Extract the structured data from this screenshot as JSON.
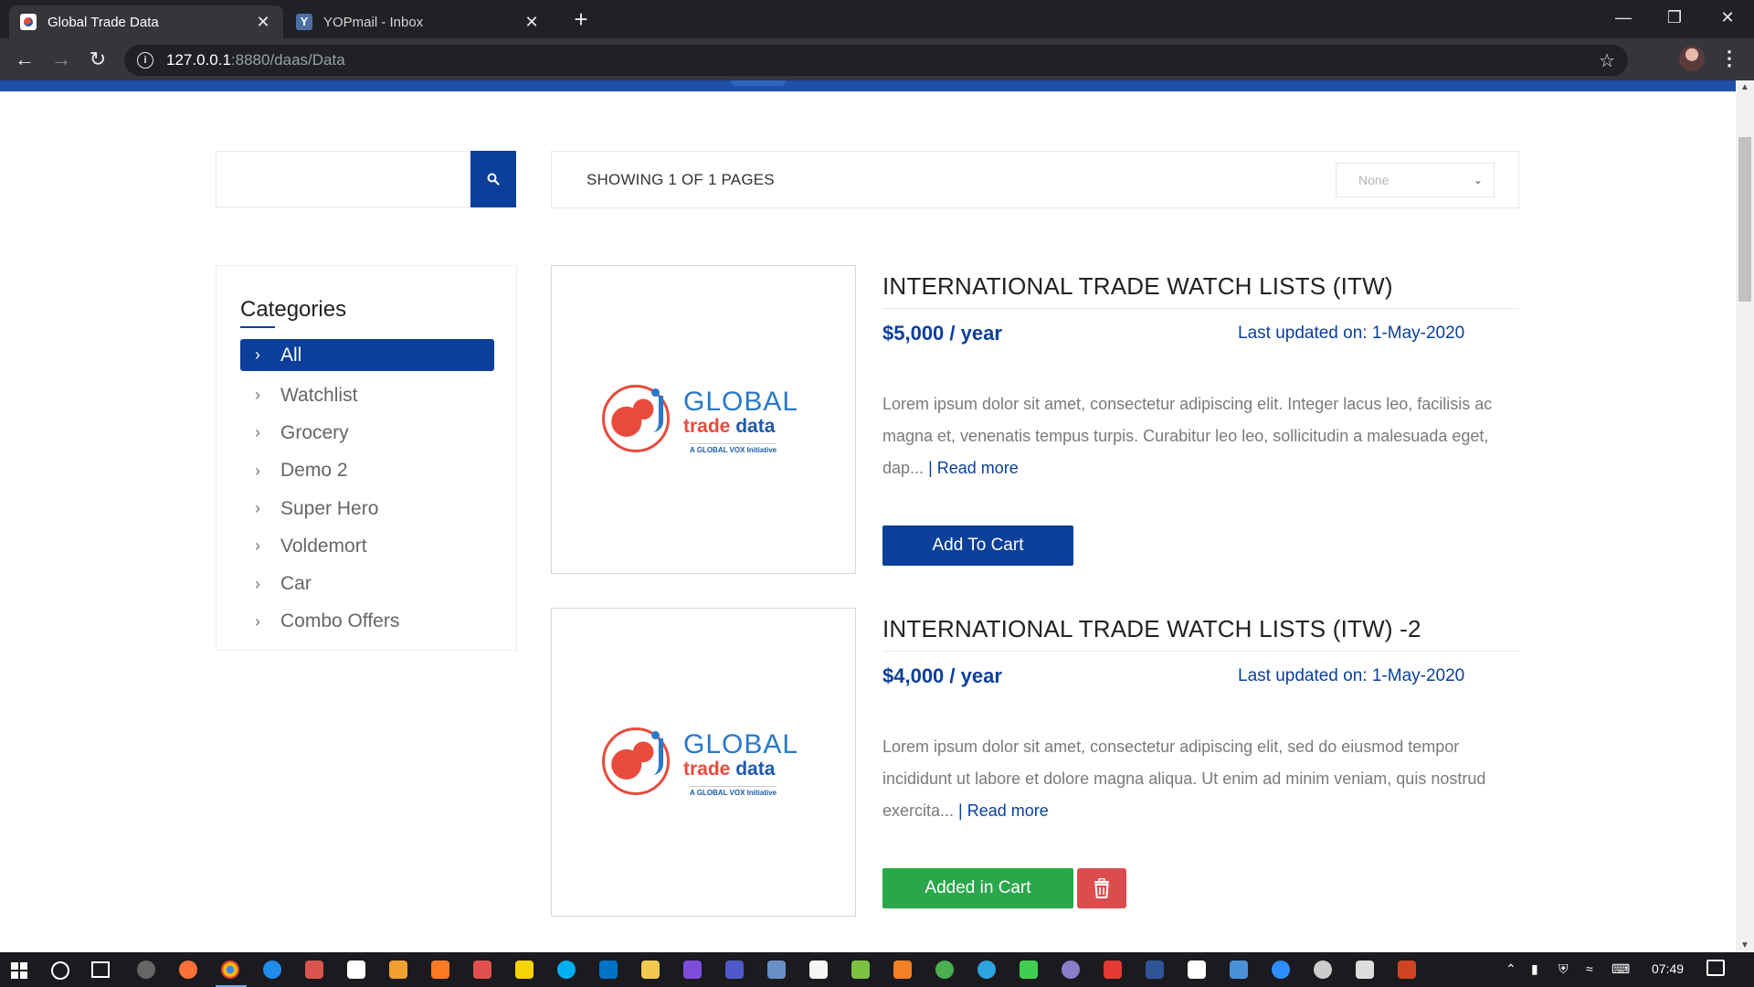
{
  "browser": {
    "tabs": [
      {
        "title": "Global Trade Data",
        "active": true
      },
      {
        "title": "YOPmail - Inbox",
        "active": false
      }
    ],
    "new_tab_symbol": "+",
    "close_symbol": "✕",
    "url_host": "127.0.0.1",
    "url_path": ":8880/daas/Data"
  },
  "search": {
    "value": "",
    "placeholder": ""
  },
  "listing": {
    "showing_text": "SHOWING 1 OF 1 PAGES",
    "sort_selected": "None"
  },
  "categories": {
    "title": "Categories",
    "items": [
      {
        "label": "All",
        "active": true
      },
      {
        "label": "Watchlist"
      },
      {
        "label": "Grocery"
      },
      {
        "label": "Demo 2"
      },
      {
        "label": "Super Hero"
      },
      {
        "label": "Voldemort"
      },
      {
        "label": "Car"
      },
      {
        "label": "Combo Offers"
      }
    ]
  },
  "logo": {
    "line1": "GLOBAL",
    "line2a": "trade",
    "line2b": "data",
    "tagline": "A GLOBAL VOX Initiative"
  },
  "products": [
    {
      "title": "INTERNATIONAL TRADE WATCH LISTS (ITW)",
      "price": "$5,000 / year",
      "updated": "Last updated on: 1-May-2020",
      "description": "Lorem ipsum dolor sit amet, consectetur adipiscing elit. Integer lacus leo, facilisis ac magna et, venenatis tempus turpis. Curabitur leo leo, sollicitudin a malesuada eget, dap...",
      "read_more": "| Read more",
      "button": "Add To Cart",
      "in_cart": false
    },
    {
      "title": "INTERNATIONAL TRADE WATCH LISTS (ITW) -2",
      "price": "$4,000 / year",
      "updated": "Last updated on: 1-May-2020",
      "description": "Lorem ipsum dolor sit amet, consectetur adipiscing elit, sed do eiusmod tempor incididunt ut labore et dolore magna aliqua. Ut enim ad minim veniam, quis nostrud exercita...",
      "read_more": "| Read more",
      "button": "Added in Cart",
      "in_cart": true
    }
  ],
  "taskbar": {
    "time": "07:49"
  },
  "colors": {
    "brand_blue": "#0b3f9a",
    "added_green": "#2aa74b",
    "delete_red": "#dc4c4c"
  }
}
